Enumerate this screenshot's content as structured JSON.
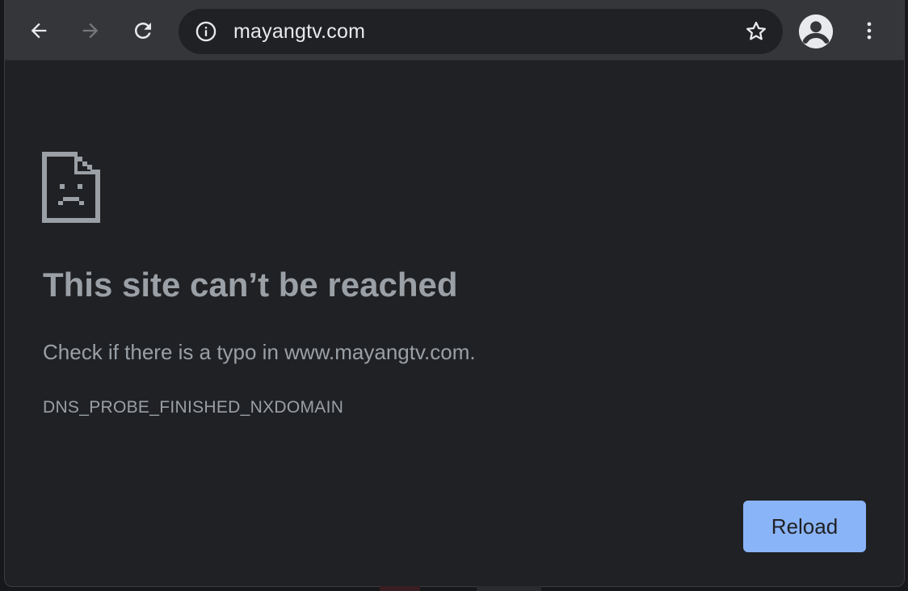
{
  "browser": {
    "url": "mayangtv.com",
    "buttons": {
      "back": "arrow-left-icon",
      "forward": "arrow-right-icon",
      "reload": "reload-icon",
      "info": "info-icon",
      "bookmark": "star-icon",
      "profile": "account-circle-icon",
      "menu": "more-vert-icon"
    }
  },
  "error_page": {
    "icon": "sad-document-icon",
    "title": "This site can’t be reached",
    "description": "Check if there is a typo in www.mayangtv.com.",
    "error_code": "DNS_PROBE_FINISHED_NXDOMAIN",
    "reload_label": "Reload"
  },
  "colors": {
    "toolbar": "#35363a",
    "page_background": "#202124",
    "text_secondary": "#9aa0a6",
    "accent": "#8ab4f8"
  }
}
